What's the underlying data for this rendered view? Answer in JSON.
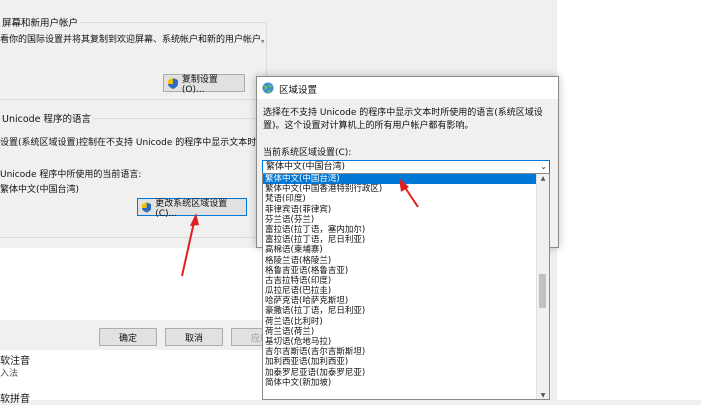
{
  "bg_window": {
    "group1_title": "屏幕和新用户帐户",
    "group1_desc": "看你的国际设置并将其复制到欢迎屏幕、系统帐户和新的用户帐户。",
    "copy_button": "复制设置(O)...",
    "group2_title": "Unicode 程序的语言",
    "group2_desc": "设置(系统区域设置)控制在不支持 Unicode 的程序中显示文本时所使用",
    "current_lang_label": "Unicode 程序中所使用的当前语言:",
    "current_lang_value": "繁体中文(中国台湾)",
    "change_button": "更改系统区域设置(C)...",
    "ok_button": "确定",
    "cancel_button": "取消",
    "apply_button": "应用",
    "bottom_item1_title": "软注音",
    "bottom_item1_sub": "入法",
    "bottom_item2_title": "软拼音"
  },
  "dialog": {
    "title": "区域设置",
    "desc": "选择在不支持 Unicode 的程序中显示文本时所使用的语言(系统区域设置)。这个设置对计算机上的所有用户帐户都有影响。",
    "current_label": "当前系统区域设置(C):",
    "current_value": "繁体中文(中国台湾)"
  },
  "dropdown_items": [
    "繁体中文(中国台湾)",
    "繁体中文(中国香港特别行政区)",
    "梵语(印度)",
    "菲律宾语(菲律宾)",
    "芬兰语(芬兰)",
    "富拉语(拉丁语，塞内加尔)",
    "富拉语(拉丁语，尼日利亚)",
    "高棉语(柬埔寨)",
    "格陵兰语(格陵兰)",
    "格鲁吉亚语(格鲁吉亚)",
    "古吉拉特语(印度)",
    "瓜拉尼语(巴拉圭)",
    "哈萨克语(哈萨克斯坦)",
    "豪撒语(拉丁语，尼日利亚)",
    "荷兰语(比利时)",
    "荷兰语(荷兰)",
    "基切语(危地马拉)",
    "吉尔吉斯语(吉尔吉斯斯坦)",
    "加利西亚语(加利西亚)",
    "加泰罗尼亚语(加泰罗尼亚)",
    "简体中文(新加坡)"
  ],
  "selected_index": 0,
  "colors": {
    "selection": "#0078d7",
    "annotation_arrow": "#e02020"
  }
}
